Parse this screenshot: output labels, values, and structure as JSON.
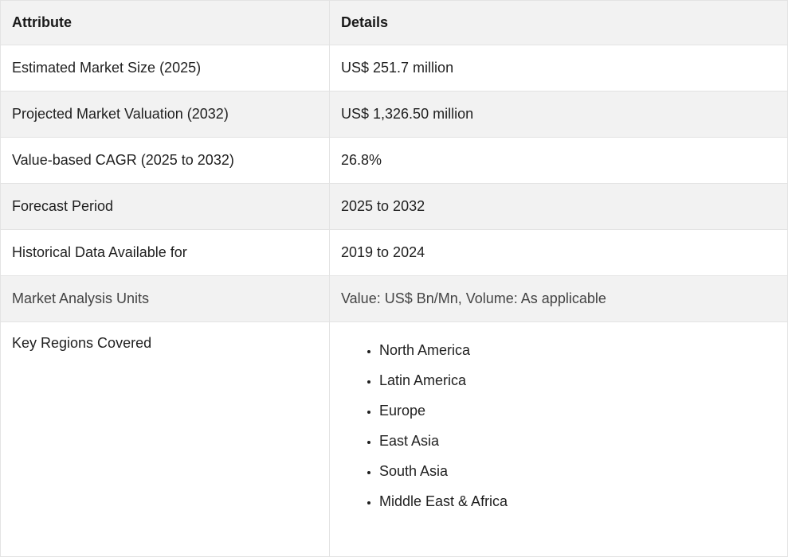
{
  "table": {
    "headers": [
      "Attribute",
      "Details"
    ],
    "rows": [
      {
        "attribute": "Estimated Market Size (2025)",
        "details": "US$ 251.7 million"
      },
      {
        "attribute": "Projected Market Valuation (2032)",
        "details": "US$ 1,326.50 million"
      },
      {
        "attribute": "Value-based CAGR (2025 to 2032)",
        "details": "26.8%"
      },
      {
        "attribute": "Forecast Period",
        "details": "2025 to 2032"
      },
      {
        "attribute": "Historical Data Available for",
        "details": "2019 to 2024"
      },
      {
        "attribute": "Market Analysis Units",
        "details": "Value: US$ Bn/Mn, Volume: As applicable"
      }
    ],
    "regions_row": {
      "attribute": "Key Regions Covered",
      "regions": [
        "North America",
        "Latin America",
        "Europe",
        "East Asia",
        "South Asia",
        "Middle East & Africa"
      ]
    }
  },
  "colors": {
    "header_bg": "#f2f2f2",
    "stripe_bg": "#f2f2f2",
    "border": "#e3e3e3",
    "text": "#1f1f1f"
  }
}
